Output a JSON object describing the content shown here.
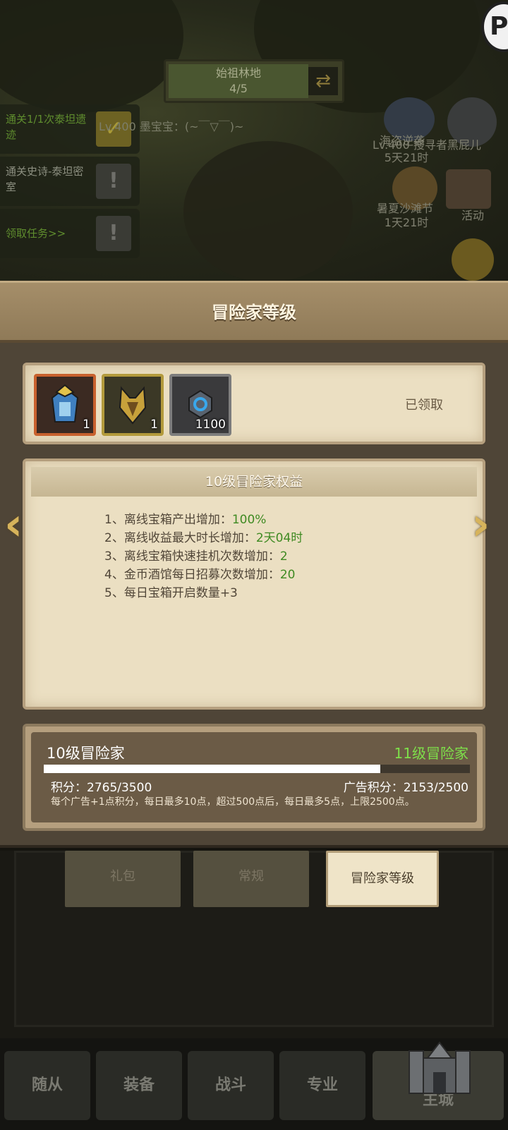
{
  "scene": {
    "stage": {
      "name": "始祖林地",
      "progress": "4/5"
    },
    "chat": "Lv.400 墨宝宝：(~￣▽￣)~",
    "quests": [
      {
        "text": "通关1/1次泰坦遗迹",
        "done": true
      },
      {
        "text": "通关史诗-泰坦密室",
        "done": false
      },
      {
        "text": "领取任务>>",
        "done": false
      }
    ],
    "side_labels": {
      "event1": "海盗逆袭",
      "player": "Lv.400 搜寻者黑屁儿",
      "timer1": "5天21时",
      "event2": "暑夏沙滩节",
      "timer2": "1天21时",
      "activity": "活动"
    }
  },
  "panel": {
    "title": "冒险家等级",
    "rewards": [
      {
        "icon": "helmet-armor-icon",
        "count": "1",
        "rarity": "orange"
      },
      {
        "icon": "beast-armor-icon",
        "count": "1",
        "rarity": "gold"
      },
      {
        "icon": "blue-gem-icon",
        "count": "1100",
        "rarity": "gray"
      }
    ],
    "claimed_label": "已领取",
    "benefit_title": "10级冒险家权益",
    "benefits": [
      {
        "label": "1、离线宝箱产出增加：",
        "value": "100%"
      },
      {
        "label": "2、离线收益最大时长增加：",
        "value": "2天04时"
      },
      {
        "label": "3、离线宝箱快速挂机次数增加：",
        "value": "2"
      },
      {
        "label": "4、金币酒馆每日招募次数增加：",
        "value": "20"
      },
      {
        "label": "5、每日宝箱开启数量+3",
        "value": ""
      }
    ],
    "current_level": "10级冒险家",
    "next_level": "11级冒险家",
    "progress": 0.79,
    "points": "积分：2765/3500",
    "ad_points": "广告积分：2153/2500",
    "note": "每个广告+1点积分，每日最多10点，超过500点后，每日最多5点，上限2500点。"
  },
  "tabs": [
    "礼包",
    "常规",
    "冒险家等级"
  ],
  "bottom_nav": [
    "随从",
    "装备",
    "战斗",
    "专业",
    "主城"
  ]
}
